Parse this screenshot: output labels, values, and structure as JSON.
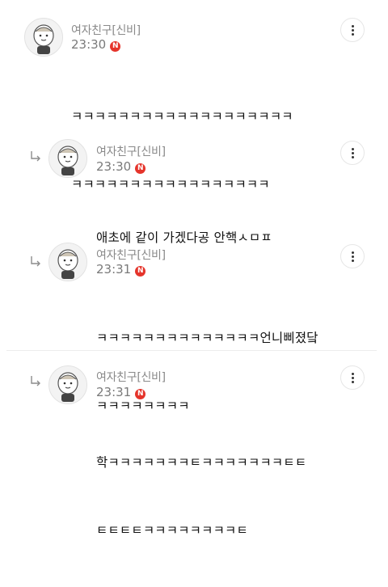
{
  "comments": [
    {
      "author": "여자친구[신비]",
      "time": "23:30",
      "badge": "N",
      "lines": [
        "ㅋㅋㅋㅋㅋㅋㅋㅋㅋㅋㅋㅋㅋㅋㅋㅋㅋㅋㅋ",
        "ㅋㅋㅋㅋㅋㅋㅋㅋㅋㅋㅋㅋㅋㅋㅋㅋㅋ"
      ]
    },
    {
      "author": "여자친구[신비]",
      "time": "23:30",
      "badge": "N",
      "lines": [
        "애초에 같이 가겠다공 안핵ㅅㅁㅍ"
      ]
    },
    {
      "author": "여자친구[신비]",
      "time": "23:31",
      "badge": "N",
      "lines": [
        "ㅋㅋㅋㅋㅋㅋㅋㅋㅋㅋㅋㅋㅋㅋ언니삐졌닼",
        "ㅋㅋㅋㅋㅋㅋㅋㅋ"
      ]
    },
    {
      "author": "여자친구[신비]",
      "time": "23:31",
      "badge": "N",
      "lines": [
        "학ㅋㅋㅋㅋㅋㅋㅋㅌㅋㅋㅋㅋㅋㅋㅋㅌㅌ",
        "ㅌㅌㅌㅌㅋㅋㅋㅋㅋㅋㅋㅋㅌ"
      ]
    }
  ],
  "icons": {
    "avatar": "character-avatar-icon",
    "more": "more-vertical-icon",
    "reply": "reply-arrow-icon"
  },
  "colors": {
    "badge": "#e5342b",
    "meta": "#8a8a8a"
  }
}
